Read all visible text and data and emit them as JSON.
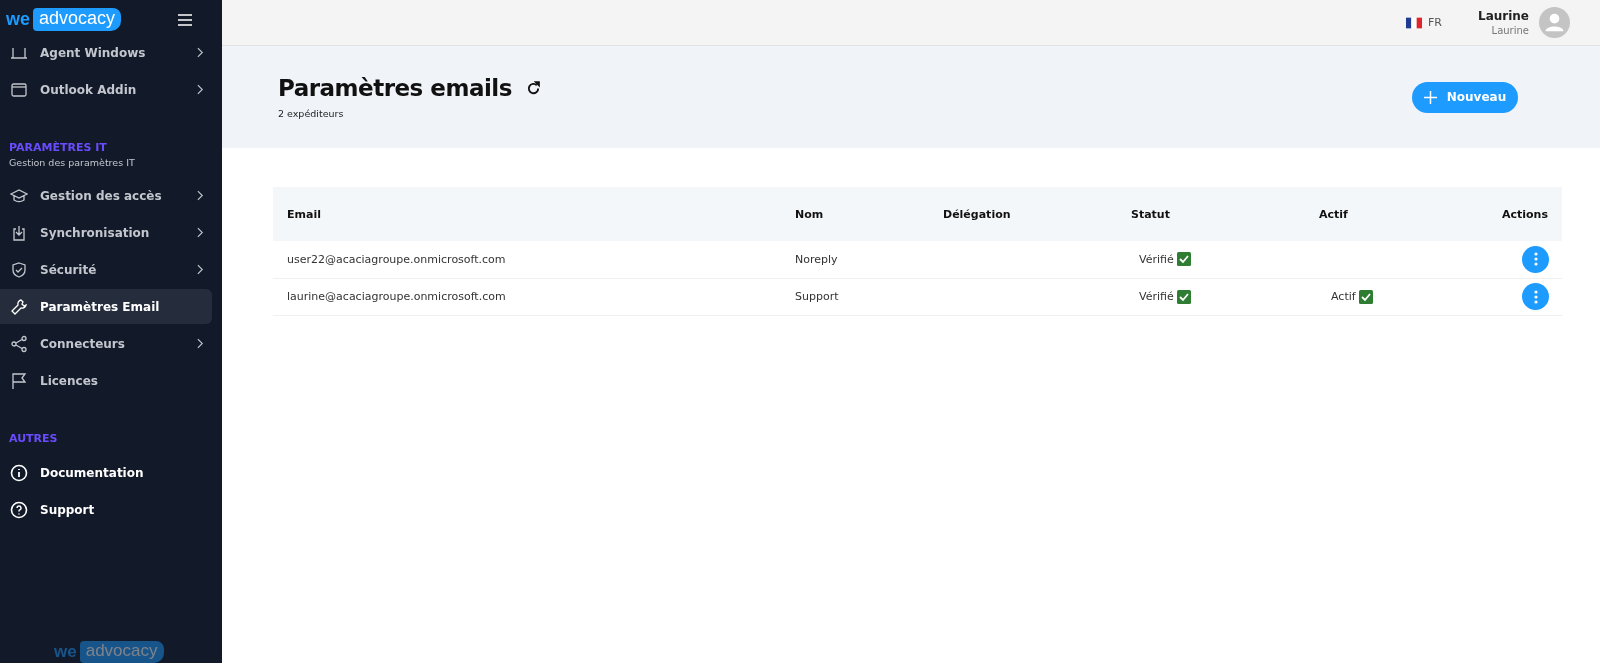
{
  "sidebar": {
    "logo": {
      "left": "we",
      "right": "advocacy"
    },
    "groups": [
      {
        "items": [
          {
            "label": "Agent Windows",
            "has_submenu": true,
            "selected": false
          },
          {
            "label": "Outlook Addin",
            "has_submenu": true,
            "selected": false
          }
        ]
      },
      {
        "title": "PARAMÈTRES IT",
        "subtitle": "Gestion des paramètres IT",
        "items": [
          {
            "label": "Gestion des accès",
            "has_submenu": true,
            "selected": false
          },
          {
            "label": "Synchronisation",
            "has_submenu": true,
            "selected": false
          },
          {
            "label": "Sécurité",
            "has_submenu": true,
            "selected": false
          },
          {
            "label": "Paramètres Email",
            "has_submenu": false,
            "selected": true
          },
          {
            "label": "Connecteurs",
            "has_submenu": true,
            "selected": false
          },
          {
            "label": "Licences",
            "has_submenu": false,
            "selected": false
          }
        ]
      },
      {
        "title": "AUTRES",
        "items": [
          {
            "label": "Documentation",
            "has_submenu": false,
            "selected": false
          },
          {
            "label": "Support",
            "has_submenu": false,
            "selected": false
          }
        ]
      }
    ],
    "footer_logo": {
      "left": "we",
      "right": "advocacy"
    }
  },
  "topbar": {
    "language": "FR",
    "user": {
      "name": "Laurine",
      "subtitle": "Laurine"
    }
  },
  "header": {
    "title": "Paramètres emails",
    "subtitle": "2 expéditeurs",
    "new_button": "Nouveau"
  },
  "table": {
    "columns": [
      "Email",
      "Nom",
      "Délégation",
      "Statut",
      "Actif",
      "Actions"
    ],
    "rows": [
      {
        "email": "user22@acaciagroupe.onmicrosoft.com",
        "nom": "Noreply",
        "statut": "Vérifié",
        "statut_checked": true,
        "actif_checked": false
      },
      {
        "email": "laurine@acaciagroupe.onmicrosoft.com",
        "nom": "Support",
        "statut": "Vérifié",
        "statut_checked": true,
        "actif": "Actif",
        "actif_checked": true
      }
    ]
  }
}
